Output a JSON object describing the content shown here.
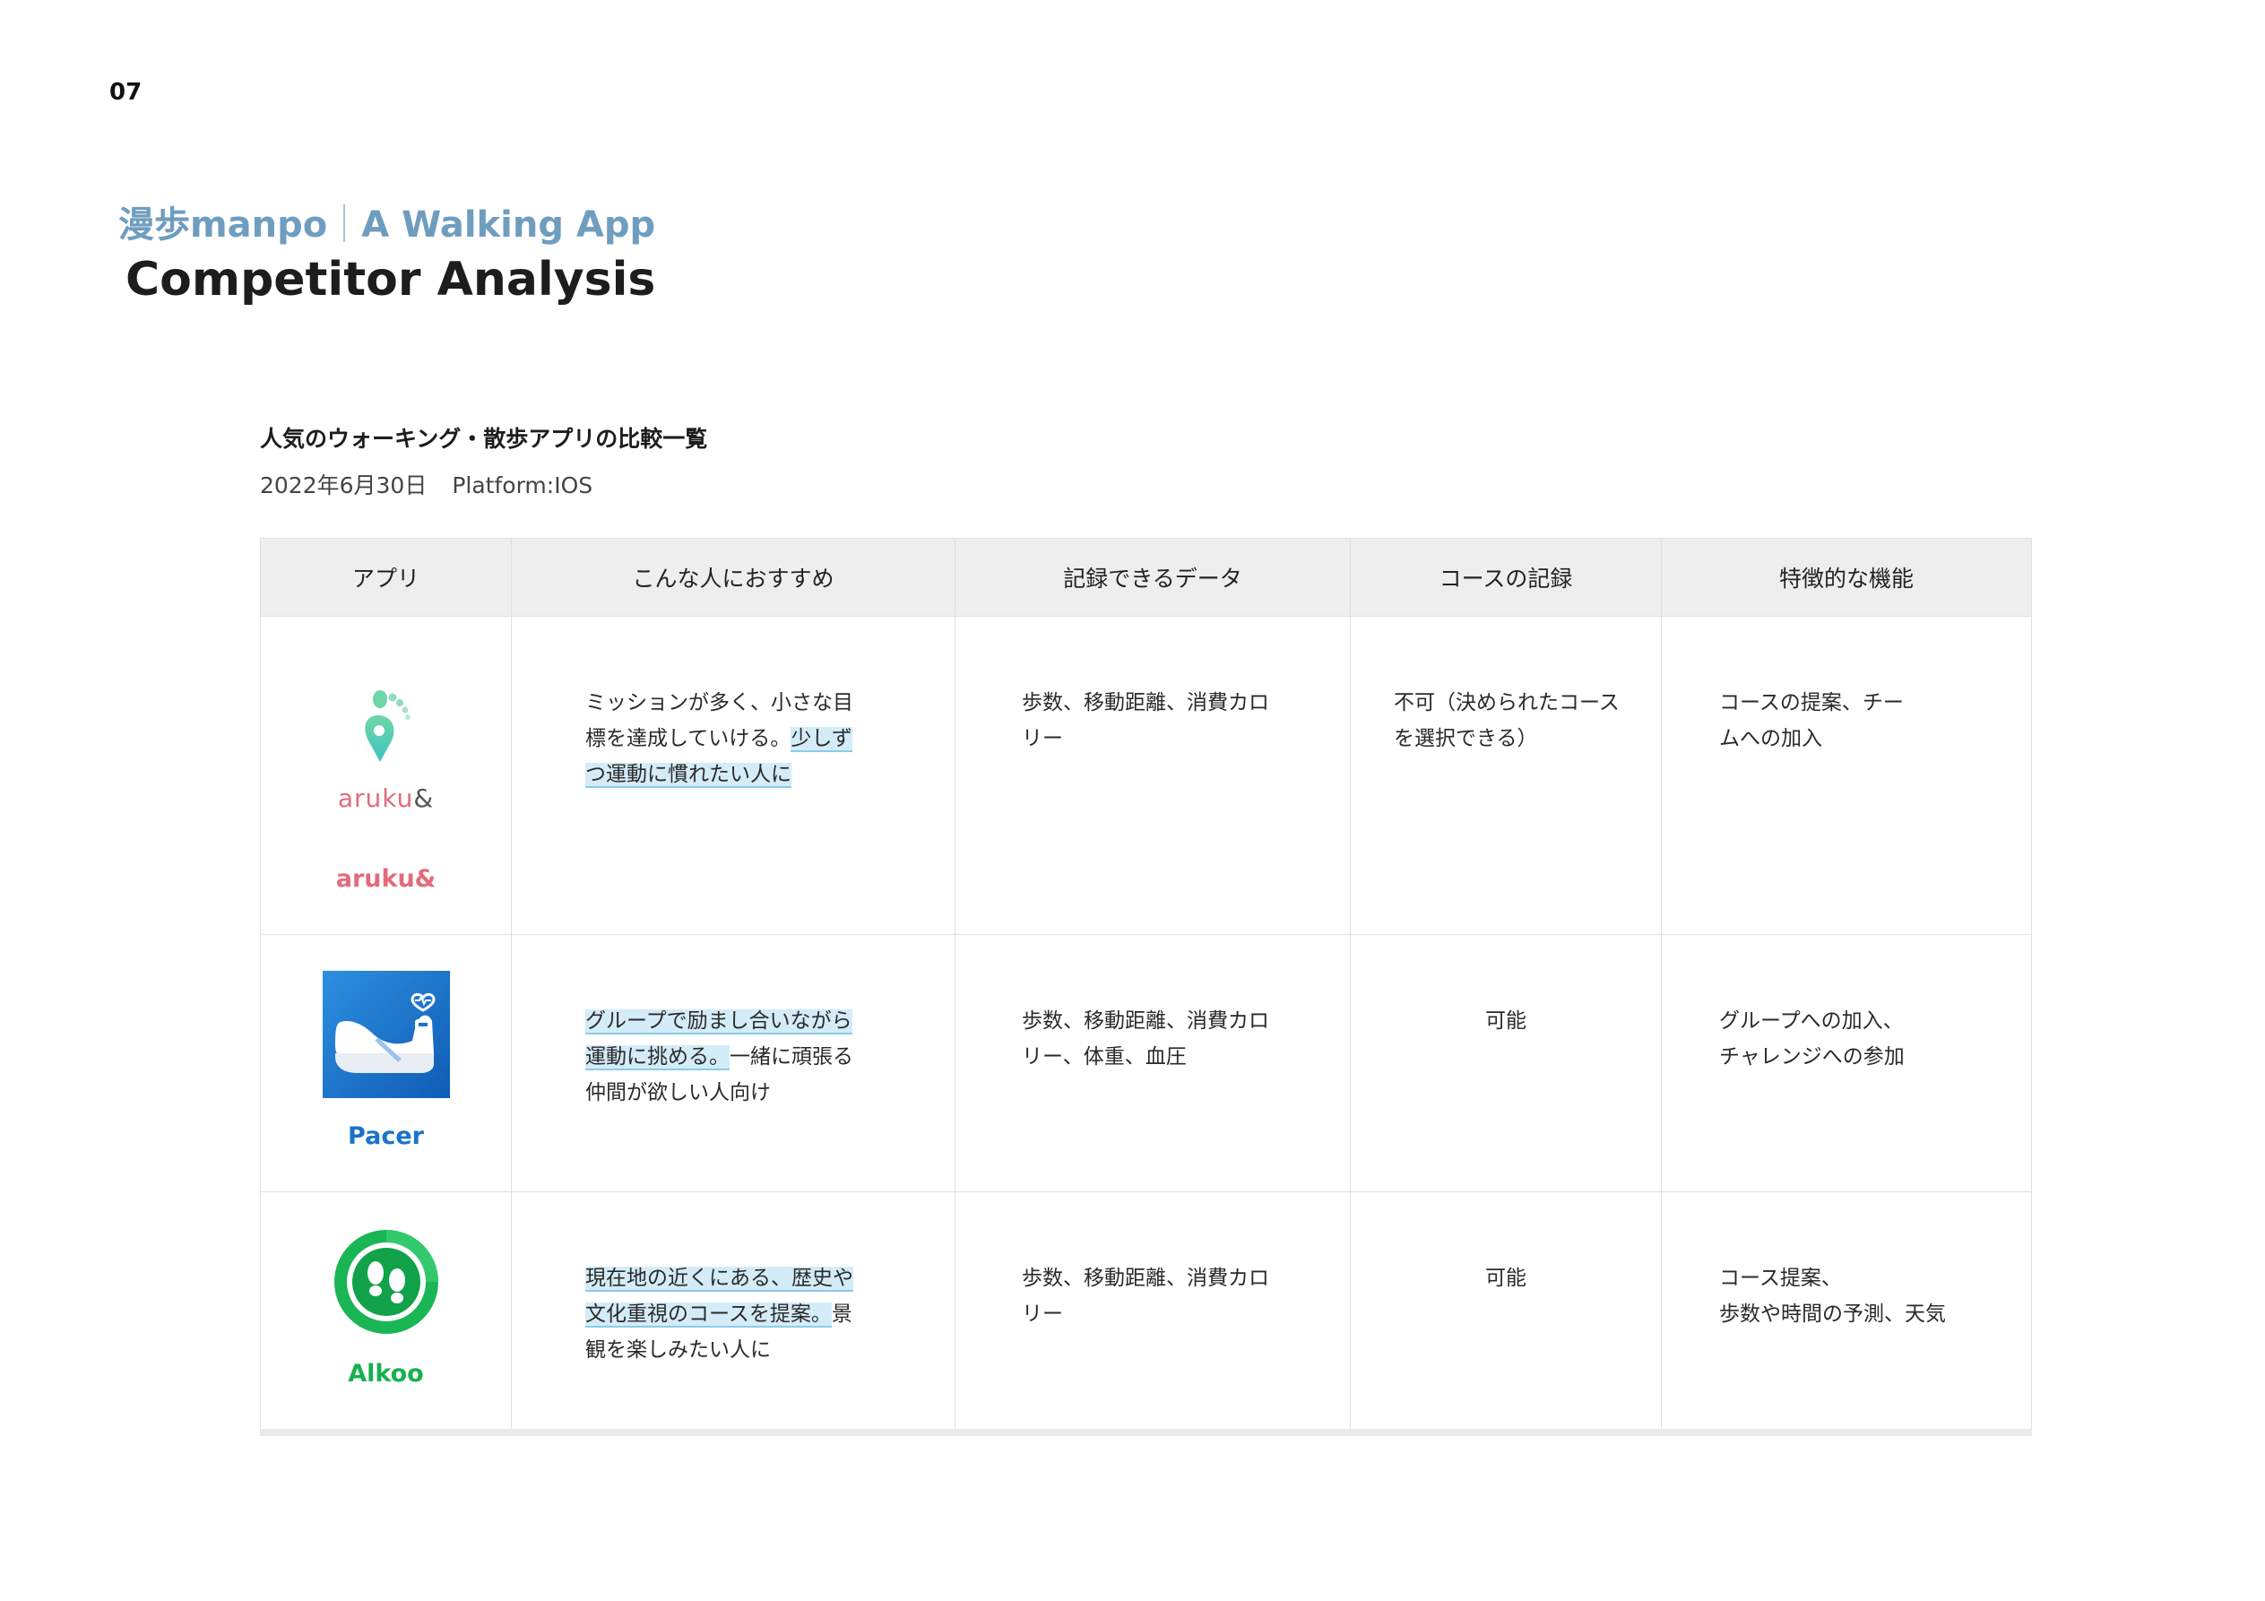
{
  "page_number": "07",
  "subtitle": {
    "left": "漫歩manpo",
    "right": "A Walking App"
  },
  "title": "Competitor Analysis",
  "table_heading": "人気のウォーキング・散歩アプリの比較一覧",
  "table_meta": {
    "date": "2022年6月30日",
    "platform": "Platform:IOS"
  },
  "table": {
    "headers": [
      "アプリ",
      "こんな人におすすめ",
      "記録できるデータ",
      "コースの記録",
      "特徴的な機能"
    ],
    "rows": [
      {
        "app_name": "aruku&",
        "logo_wordmark": "aruku",
        "logo_amp": "&",
        "recommend_plain": "ミッションが多く、小さな目\n標を達成していける。",
        "recommend_hl": "少しず\nつ運動に慣れたい人に",
        "data": "歩数、移動距離、消費カロ\nリー",
        "course": "不可（決められたコース\nを選択できる）",
        "feature": "コースの提案、チー\nムへの加入"
      },
      {
        "app_name": "Pacer",
        "recommend_hl": "グループで励まし合いながら\n運動に挑める。",
        "recommend_plain": "一緒に頑張る\n仲間が欲しい人向け",
        "data": "歩数、移動距離、消費カロ\nリー、体重、血圧",
        "course": "可能",
        "feature": "グループへの加入、\nチャレンジへの参加"
      },
      {
        "app_name": "Alkoo",
        "recommend_hl": "現在地の近くにある、歴史や\n文化重視のコースを提案。",
        "recommend_plain": "景\n観を楽しみたい人に",
        "data": "歩数、移動距離、消費カロ\nリー",
        "course": "可能",
        "feature": "コース提案、\n歩数や時間の予測、天気"
      }
    ]
  },
  "colors": {
    "subtitle": "#6f9dbf",
    "highlight": "#d4ecf8",
    "aruku_pink": "#e26b7c",
    "aruku_teal": "#4fcfb0",
    "pacer_blue": "#1a73c9",
    "alkoo_green": "#17b04f"
  },
  "icons": [
    "aruku-footprint-pin-logo",
    "pacer-shoe-logo",
    "alkoo-footprints-logo"
  ]
}
